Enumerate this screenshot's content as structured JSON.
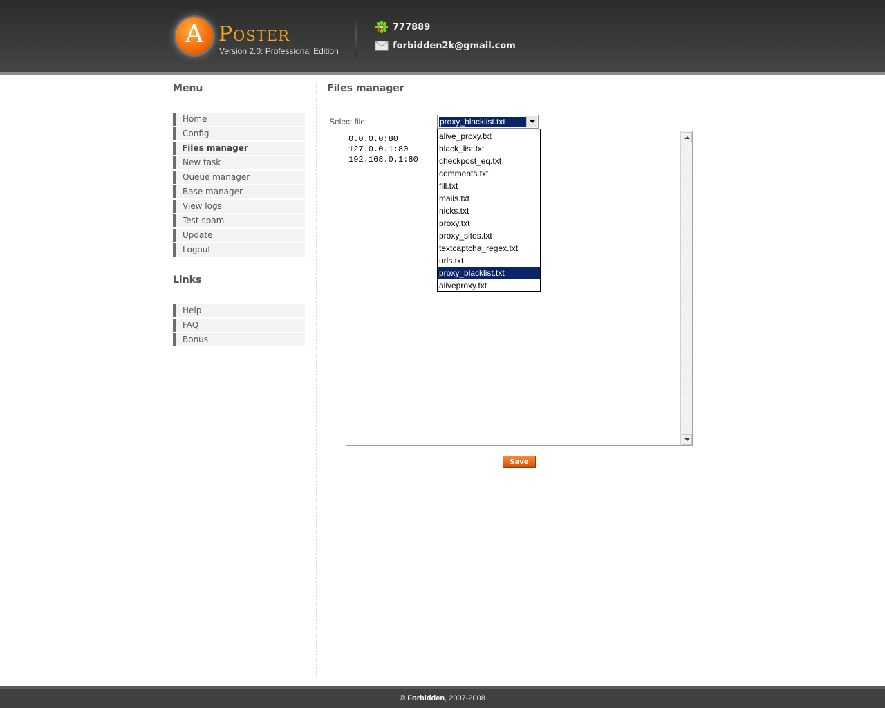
{
  "header": {
    "logo_letter": "A",
    "logo_word": "Poster",
    "version": "Version 2.0: Professional Edition",
    "icq": "777889",
    "email": "forbidden2k@gmail.com",
    "icq_icon": "icq-flower-icon",
    "email_icon": "envelope-icon"
  },
  "sidebar": {
    "menu_title": "Menu",
    "menu_items": [
      {
        "label": "Home"
      },
      {
        "label": "Config"
      },
      {
        "label": "Files manager",
        "active": true
      },
      {
        "label": "New task"
      },
      {
        "label": "Queue manager"
      },
      {
        "label": "Base manager"
      },
      {
        "label": "View logs"
      },
      {
        "label": "Test spam"
      },
      {
        "label": "Update"
      },
      {
        "label": "Logout"
      }
    ],
    "links_title": "Links",
    "link_items": [
      {
        "label": "Help"
      },
      {
        "label": "FAQ"
      },
      {
        "label": "Bonus"
      }
    ]
  },
  "main": {
    "title": "Files manager",
    "select_label": "Select file:",
    "selected_file": "proxy_blacklist.txt",
    "file_options": [
      "alive_proxy.txt",
      "black_list.txt",
      "checkpost_eq.txt",
      "comments.txt",
      "fill.txt",
      "mails.txt",
      "nicks.txt",
      "proxy.txt",
      "proxy_sites.txt",
      "textcaptcha_regex.txt",
      "urls.txt",
      "proxy_blacklist.txt",
      "aliveproxy.txt"
    ],
    "editor_lines": [
      "0.0.0.0:80",
      "127.0.0.1:80",
      "192.168.0.1:80"
    ],
    "save_label": "Save"
  },
  "footer": {
    "copyright_symbol": "©",
    "owner": "Forbidden",
    "years": ", 2007-2008"
  },
  "colors": {
    "accent_orange": "#e8620f",
    "selection_blue": "#0a246a",
    "header_dark": "#333333"
  }
}
